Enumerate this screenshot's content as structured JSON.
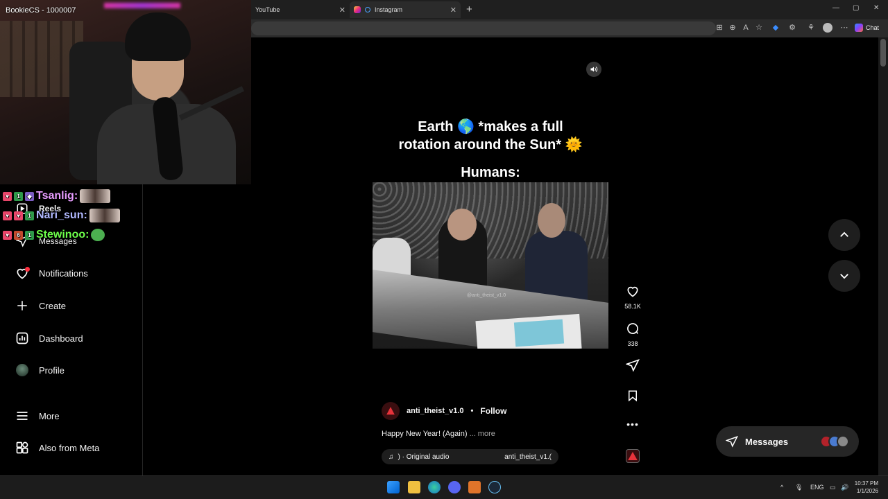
{
  "browser": {
    "tabs": [
      {
        "title": "YouTube",
        "active": false
      },
      {
        "title": "Instagram",
        "active": true
      }
    ],
    "new_tab": "+",
    "close": "✕",
    "chat_label": "Chat",
    "window_controls": {
      "min": "—",
      "max": "▢",
      "close": "✕"
    },
    "toolbar_icons": [
      "grid-icon",
      "zoom-icon",
      "read-aloud-icon",
      "favorite-icon",
      "extension-icon",
      "puzzle-icon",
      "extensions-icon",
      "profile-icon",
      "menu-icon"
    ]
  },
  "stream": {
    "streamer_label": "BookieCS - 1000007",
    "chat": [
      {
        "user": "Tsanlig:",
        "color": "#e79cff"
      },
      {
        "user": "Nari_sun:",
        "color": "#b0b8ff"
      },
      {
        "user": "Stewinoo:",
        "color": "#6dff4a"
      }
    ]
  },
  "sidebar": {
    "items": [
      {
        "label": "Reels",
        "icon": "reels-icon"
      },
      {
        "label": "Messages",
        "icon": "messages-icon"
      },
      {
        "label": "Notifications",
        "icon": "heart-icon"
      },
      {
        "label": "Create",
        "icon": "plus-icon"
      },
      {
        "label": "Dashboard",
        "icon": "dashboard-icon"
      },
      {
        "label": "Profile",
        "icon": "avatar-icon"
      },
      {
        "label": "More",
        "icon": "hamburger-icon"
      },
      {
        "label": "Also from Meta",
        "icon": "meta-apps-icon"
      }
    ]
  },
  "reel": {
    "caption_line1": "Earth 🌎 *makes a full",
    "caption_line2": "rotation around the Sun* 🌞",
    "caption_line3": "Humans:",
    "watermark": "@anti_theist_v1.0",
    "author": "anti_theist_v1.0",
    "separator": "•",
    "follow_label": "Follow",
    "description": "Happy New Year! (Again)",
    "more_label": "... more",
    "audio_label": ") · Original audio",
    "audio_author": "anti_theist_v1.(",
    "likes": "58.1K",
    "comments": "338"
  },
  "messages_pill": {
    "label": "Messages"
  },
  "taskbar": {
    "lang": "ENG",
    "time": "10:37 PM",
    "date": "1/1/2026"
  },
  "colors": {
    "accent_red": "#ff3040",
    "bg": "#000000",
    "pill": "#262626"
  }
}
